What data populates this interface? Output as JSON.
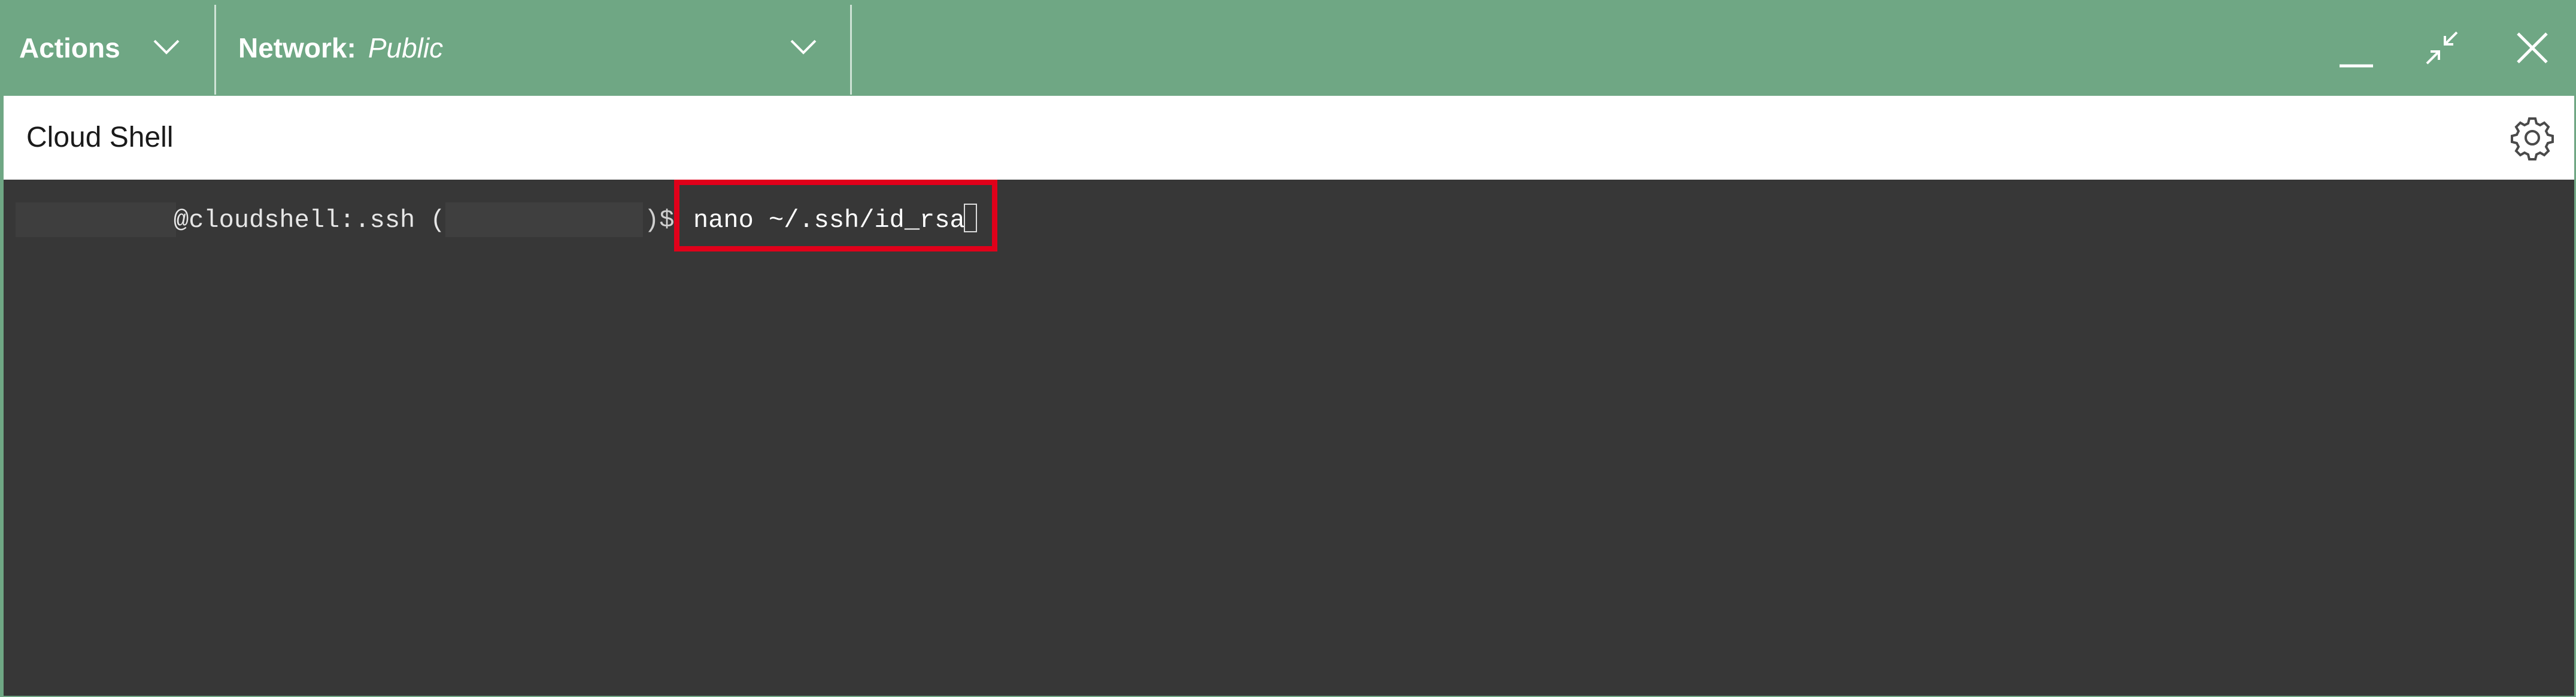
{
  "toolbar": {
    "actions_label": "Actions",
    "network_label": "Network:",
    "network_value": "Public",
    "minimize_icon": "minimize-icon",
    "restore_icon": "restore-icon",
    "close_icon": "close-icon"
  },
  "shell": {
    "title": "Cloud Shell",
    "settings_icon": "gear-icon"
  },
  "terminal": {
    "prompt_host": "@cloudshell:.ssh (",
    "prompt_tail": ")$",
    "command": "nano ~/.ssh/id_rsa"
  },
  "colors": {
    "toolbar_bg": "#6fa784",
    "terminal_bg": "#373737",
    "highlight": "#e0001a"
  }
}
